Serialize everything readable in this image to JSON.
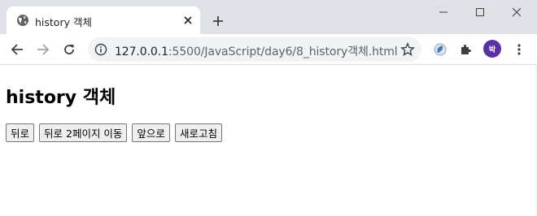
{
  "browser": {
    "tab": {
      "title": "history 객체",
      "favicon": "globe-icon",
      "close_icon": "close-icon"
    },
    "new_tab_icon": "plus-icon",
    "window_controls": [
      "minimize-icon",
      "maximize-icon",
      "close-icon"
    ],
    "nav": {
      "back": "arrow-left-icon",
      "forward": "arrow-right-icon",
      "reload": "reload-icon"
    },
    "address": {
      "host": "127.0.0.1",
      "path": ":5500/JavaScript/day6/8_history객체.html"
    },
    "avatar_label": "박",
    "accent_color": "#5b2fa6"
  },
  "page": {
    "heading": "history 객체",
    "buttons": {
      "back": "뒤로",
      "back2": "뒤로 2페이지 이동",
      "forward": "앞으로",
      "refresh": "새로고침"
    }
  }
}
